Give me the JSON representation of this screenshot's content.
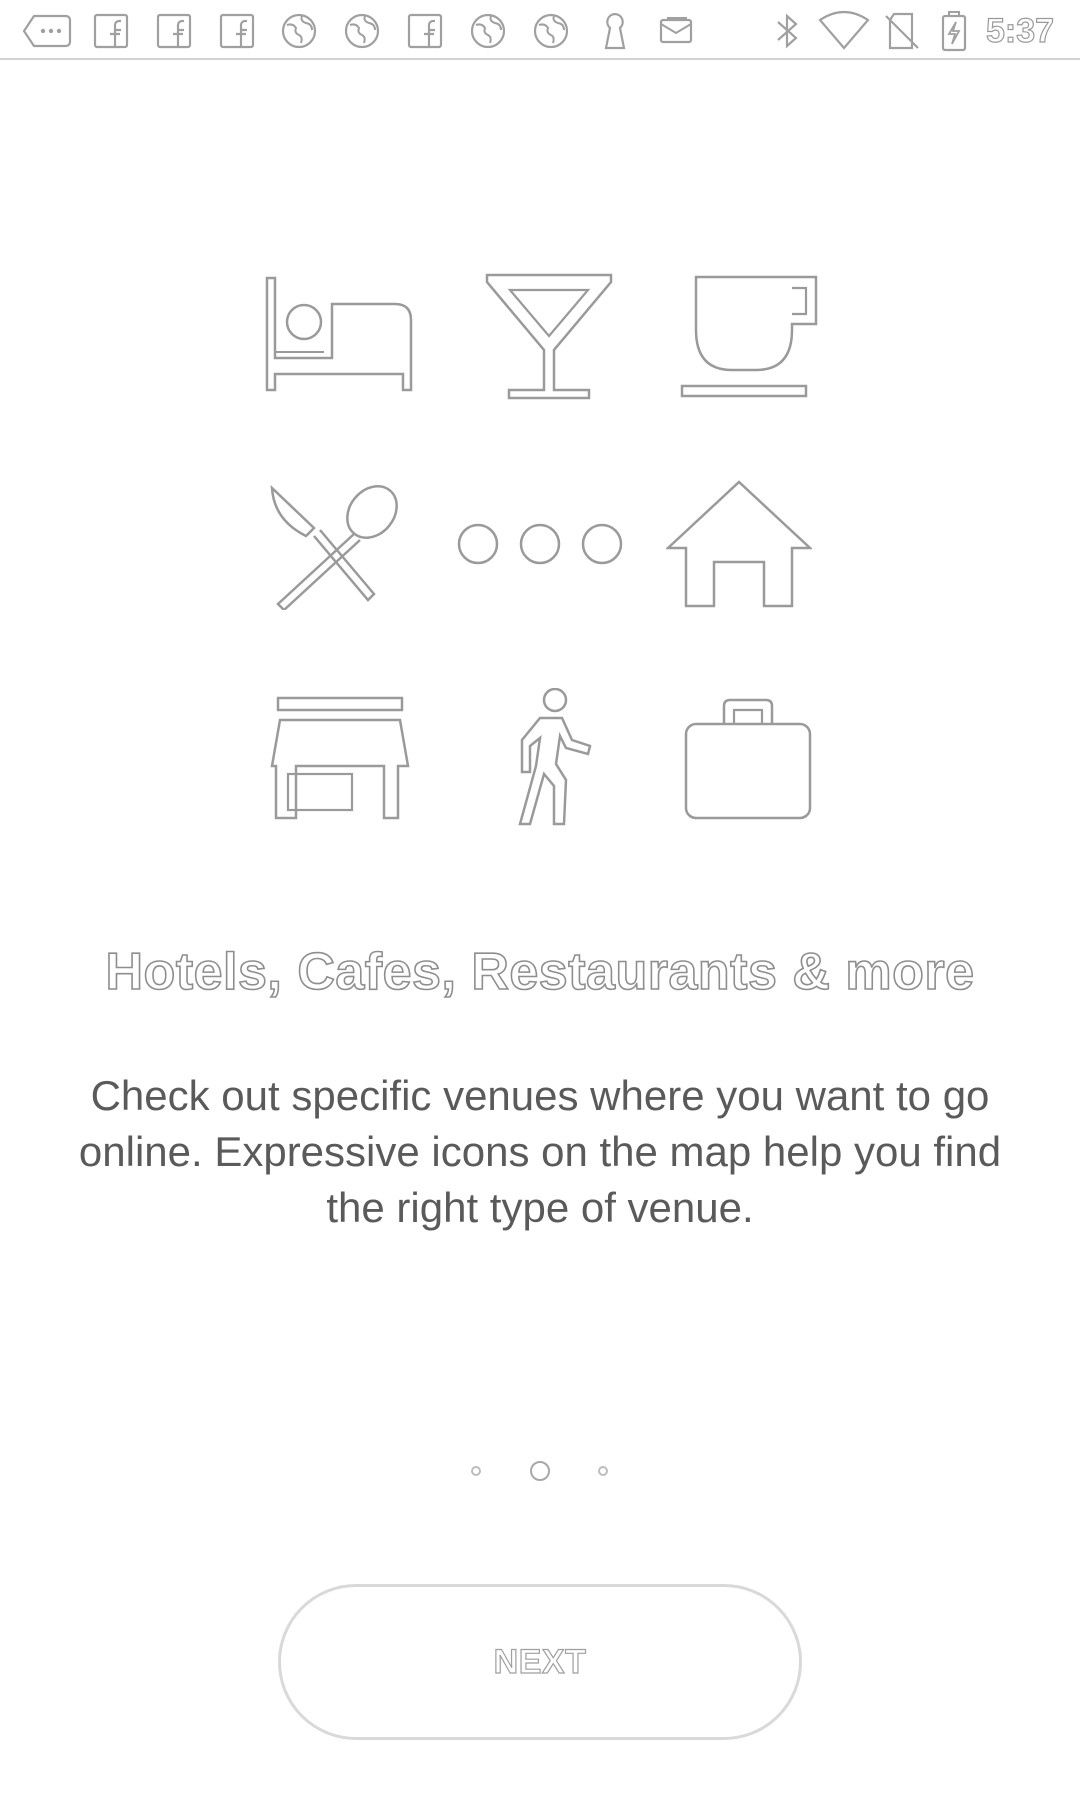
{
  "status_bar": {
    "time": "5:37",
    "notification_icons": [
      "more-icon",
      "facebook-icon",
      "facebook-icon",
      "facebook-icon",
      "globe-icon",
      "globe-icon",
      "facebook-icon",
      "globe-icon",
      "globe-icon",
      "keyhole-icon",
      "message-icon"
    ],
    "system_icons": [
      "bluetooth-icon",
      "wifi-icon",
      "no-sim-icon",
      "battery-charging-icon"
    ]
  },
  "venue_icons": [
    "bed-icon",
    "cocktail-icon",
    "coffee-cup-icon",
    "restaurant-icon",
    "more-dots-icon",
    "home-icon",
    "store-icon",
    "walking-icon",
    "briefcase-icon"
  ],
  "onboarding": {
    "title": "Hotels, Cafes, Restaurants & more",
    "description": "Check out specific venues where you want to go online. Expressive icons on the map help you find the right type of venue.",
    "page_index": 2,
    "page_count": 3,
    "next_label": "NEXT"
  },
  "colors": {
    "background": "#ffffff",
    "outline": "#9a9a9a",
    "text": "#5a5a5a"
  }
}
